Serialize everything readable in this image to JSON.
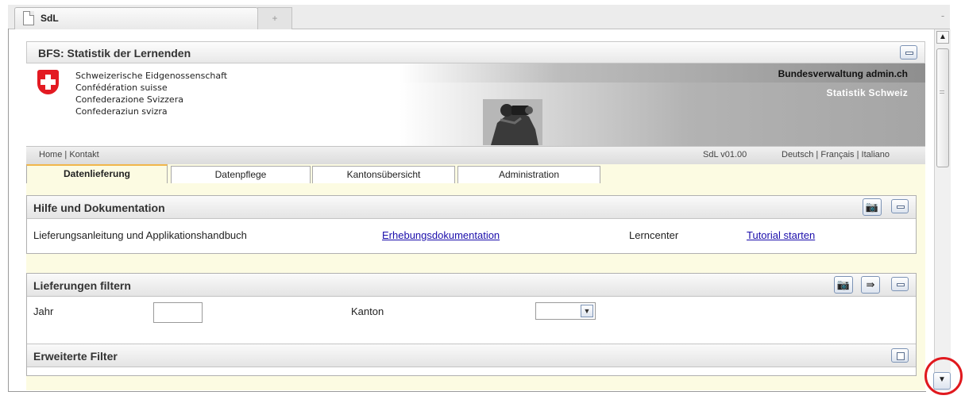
{
  "browser": {
    "tab_title": "SdL",
    "new_tab_symbol": "+",
    "tab_menu_symbol": "-"
  },
  "app": {
    "title": "BFS: Statistik der Lernenden"
  },
  "banner": {
    "confederation": [
      "Schweizerische Eidgenossenschaft",
      "Confédération suisse",
      "Confederazione Svizzera",
      "Confederaziun svizra"
    ],
    "admin": "Bundesverwaltung admin.ch",
    "statistik": "Statistik Schweiz"
  },
  "nav": {
    "home": "Home",
    "kontakt": "Kontakt",
    "version": "SdL v01.00",
    "languages": [
      "Deutsch",
      "Français",
      "Italiano"
    ]
  },
  "tabs": [
    {
      "label": "Datenlieferung",
      "active": true
    },
    {
      "label": "Datenpflege",
      "active": false
    },
    {
      "label": "Kantonsübersicht",
      "active": false
    },
    {
      "label": "Administration",
      "active": false
    }
  ],
  "help": {
    "title": "Hilfe und Dokumentation",
    "guide_label": "Lieferungsanleitung und Applikationshandbuch",
    "doc_link": "Erhebungsdokumentation",
    "learn_label": "Lerncenter",
    "tutorial_link": "Tutorial starten"
  },
  "filter": {
    "title": "Lieferungen filtern",
    "jahr_label": "Jahr",
    "jahr_value": "",
    "kanton_label": "Kanton",
    "kanton_value": ""
  },
  "extended": {
    "title": "Erweiterte Filter"
  },
  "colors": {
    "active_tab_accent": "#f1b64b",
    "panel_bg": "#fcfbe2",
    "swiss_red": "#e31a22",
    "highlight_circle": "#e0191e"
  }
}
